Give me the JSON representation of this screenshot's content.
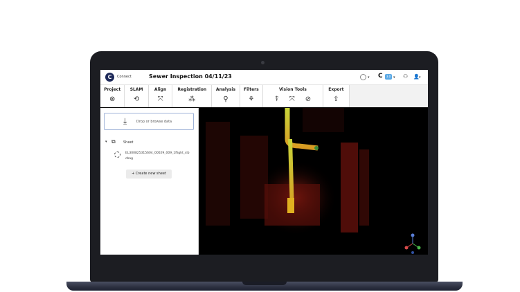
{
  "header": {
    "logo_letter": "C",
    "logo_text": "Connect",
    "project_title": "Sewer Inspection 04/11/23",
    "brand_letter": "C",
    "brand_badge": "3.0",
    "caret": "▾",
    "network_icon_glyph": "⚇",
    "user_icon_glyph": "👤"
  },
  "toolbar": {
    "groups": [
      {
        "label": "Project",
        "icons": [
          "⊗"
        ],
        "icon_names": [
          "close-circle-icon"
        ]
      },
      {
        "label": "SLAM",
        "icons": [
          "⟲"
        ],
        "icon_names": [
          "loop-icon"
        ]
      },
      {
        "label": "Align",
        "icons": [
          "⤧"
        ],
        "icon_names": [
          "align-axes-icon"
        ]
      },
      {
        "label": "Registration",
        "icons": [
          "⁂"
        ],
        "icon_names": [
          "registration-icon"
        ]
      },
      {
        "label": "Analysis",
        "icons": [
          "⚲"
        ],
        "icon_names": [
          "analysis-icon"
        ]
      },
      {
        "label": "Filters",
        "icons": [
          "⚘"
        ],
        "icon_names": [
          "filter-icon"
        ]
      },
      {
        "label": "Vision Tools",
        "icons": [
          "⍒",
          "⤧",
          "⊘"
        ],
        "icon_names": [
          "vision-probe-icon",
          "vision-axes-icon",
          "vision-mask-icon"
        ]
      },
      {
        "label": "Export",
        "icons": [
          "⇪"
        ],
        "icon_names": [
          "export-icon"
        ]
      }
    ]
  },
  "sidebar": {
    "dropzone_icon": "⤓",
    "dropzone_text": "Drop or browse data",
    "tree_caret": "▾",
    "sheet_icon": "⧉",
    "sheet_label": "Sheet",
    "file_name_line1": "EL300825315604_00029_009_1flight_slb",
    "file_name_line2": "cbag",
    "create_button": "+ Create new sheet"
  },
  "colors": {
    "header_bg": "#ffffff",
    "viewport_bg": "#000000",
    "pipe_highlight": "#c8d63a",
    "point_cloud": "#8a1510",
    "dropzone_border": "#9fb3d8",
    "brand_badge": "#5aa9e6"
  }
}
